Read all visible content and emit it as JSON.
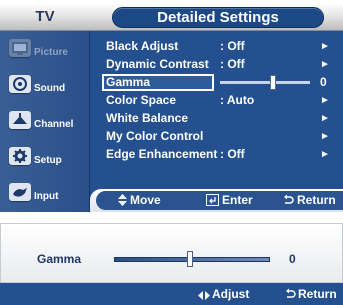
{
  "header": {
    "category": "TV",
    "title": "Detailed Settings"
  },
  "sidebar": {
    "items": [
      {
        "label": "Picture",
        "icon": "picture-icon",
        "state": "dimmed"
      },
      {
        "label": "Sound",
        "icon": "sound-icon",
        "state": "normal"
      },
      {
        "label": "Channel",
        "icon": "channel-icon",
        "state": "normal"
      },
      {
        "label": "Setup",
        "icon": "setup-icon",
        "state": "normal"
      },
      {
        "label": "Input",
        "icon": "input-icon",
        "state": "normal"
      }
    ]
  },
  "menu": {
    "items": [
      {
        "label": "Black Adjust",
        "value": ": Off",
        "arrow": "►"
      },
      {
        "label": "Dynamic Contrast",
        "value": ": Off",
        "arrow": "►"
      },
      {
        "label": "Gamma",
        "value": "0",
        "selected": true,
        "level": 0.5
      },
      {
        "label": "Color Space",
        "value": ": Auto",
        "arrow": "►"
      },
      {
        "label": "White Balance",
        "arrow": "►"
      },
      {
        "label": "My Color Control",
        "arrow": "►"
      },
      {
        "label": "Edge Enhancement",
        "value": ": Off",
        "arrow": "►"
      }
    ]
  },
  "footer": {
    "move": "Move",
    "enter": "Enter",
    "return": "Return"
  },
  "gamma_popup": {
    "label": "Gamma",
    "value": "0",
    "level": 0.5,
    "adjust": "Adjust",
    "return": "Return"
  },
  "colors": {
    "osd_blue": "#24508f",
    "title_pill": "#1d4886",
    "text": "#ffffff"
  }
}
